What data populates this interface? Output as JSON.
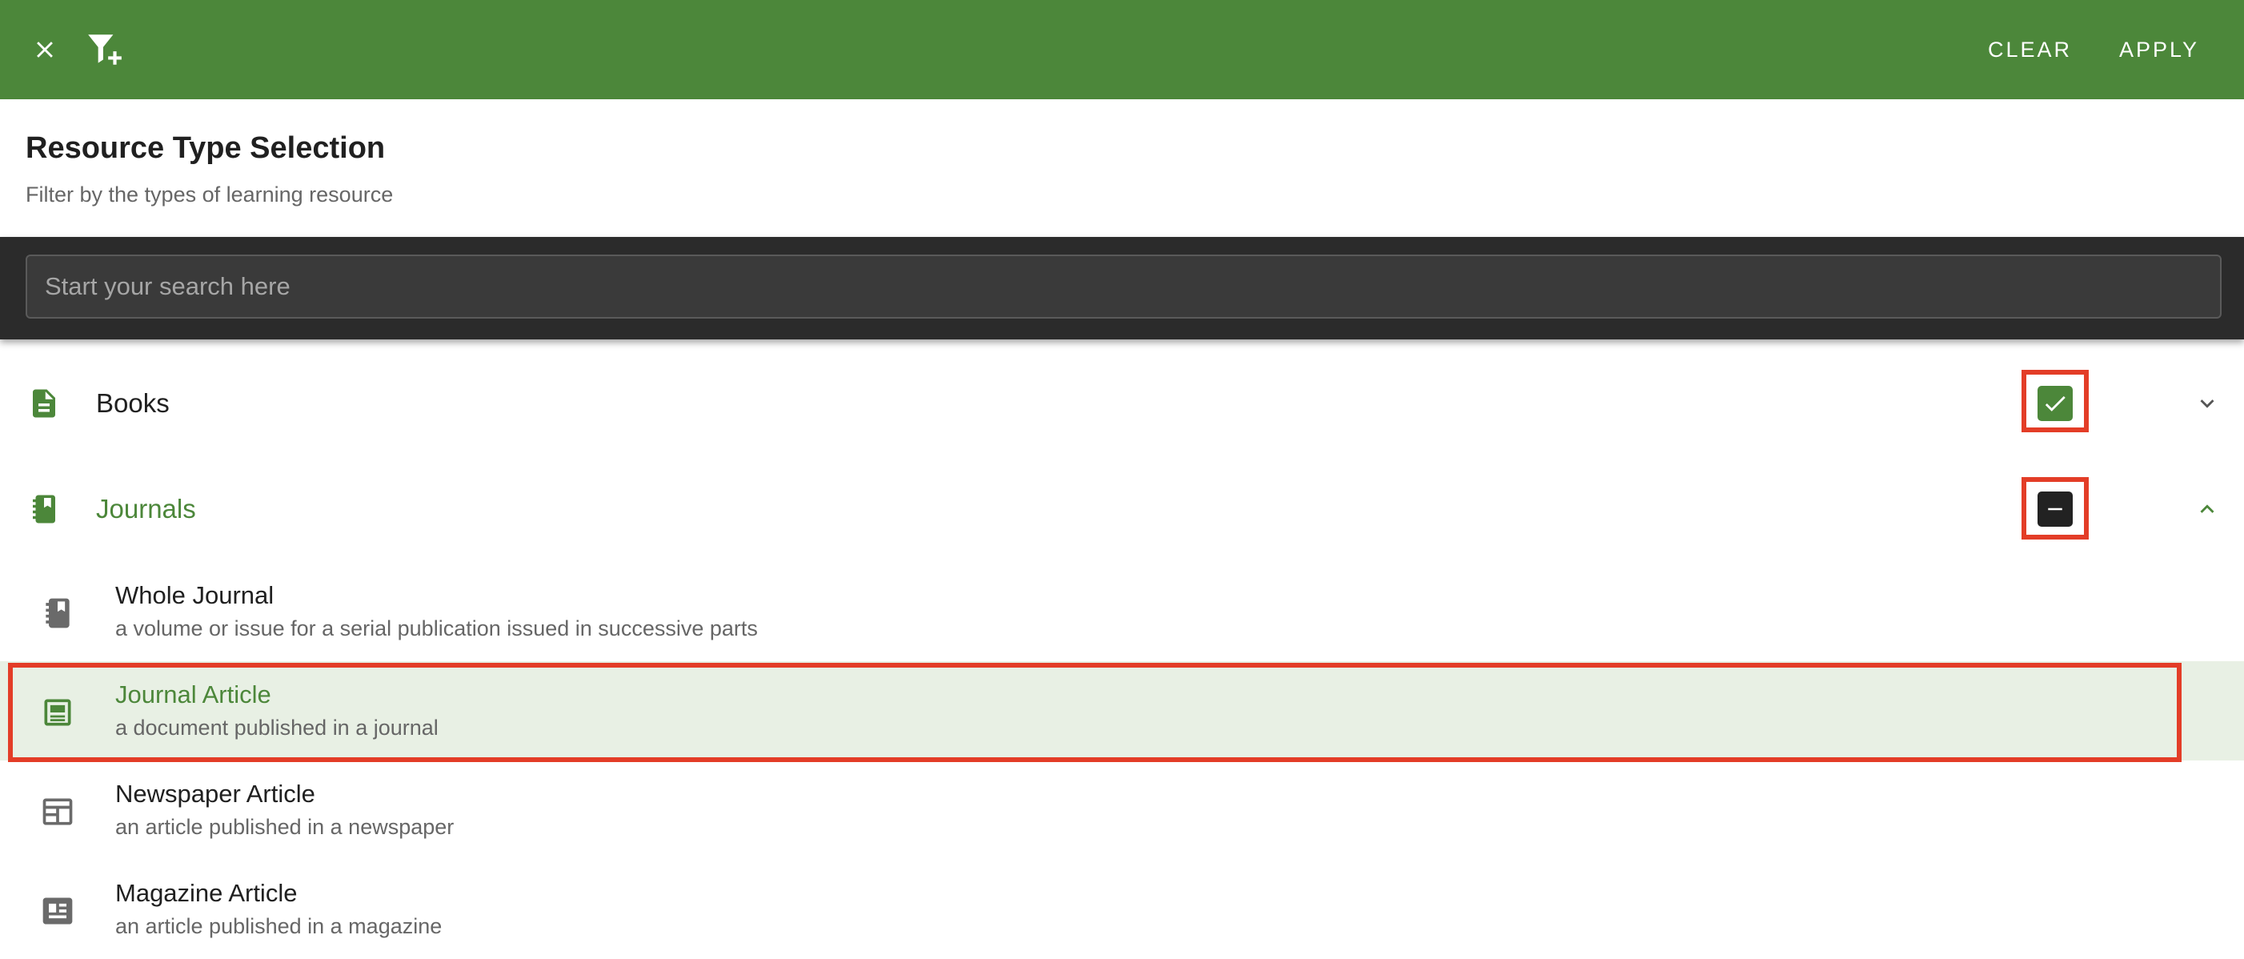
{
  "toolbar": {
    "clear_label": "CLEAR",
    "apply_label": "APPLY",
    "close_icon": "close-icon",
    "filter_icon": "filter-add-icon",
    "background": "#4c873a"
  },
  "header": {
    "title": "Resource Type Selection",
    "subtitle": "Filter by the types of learning resource"
  },
  "search": {
    "placeholder": "Start your search here",
    "value": ""
  },
  "categories": [
    {
      "label": "Books",
      "icon": "document-icon",
      "checkbox_state": "checked",
      "expanded": false
    },
    {
      "label": "Journals",
      "icon": "journal-icon",
      "checkbox_state": "indeterminate",
      "expanded": true,
      "items": [
        {
          "title": "Whole Journal",
          "description": "a volume or issue for a serial publication issued in successive parts",
          "icon": "journal-icon",
          "selected": false
        },
        {
          "title": "Journal Article",
          "description": "a document published in a journal",
          "icon": "article-icon",
          "selected": true
        },
        {
          "title": "Newspaper Article",
          "description": "an article published in a newspaper",
          "icon": "newspaper-icon",
          "selected": false
        },
        {
          "title": "Magazine Article",
          "description": "an article published in a magazine",
          "icon": "magazine-icon",
          "selected": false
        }
      ]
    }
  ],
  "colors": {
    "accent": "#4c873a",
    "selected_row": "#e8f0e4",
    "highlight": "#e33d27"
  }
}
